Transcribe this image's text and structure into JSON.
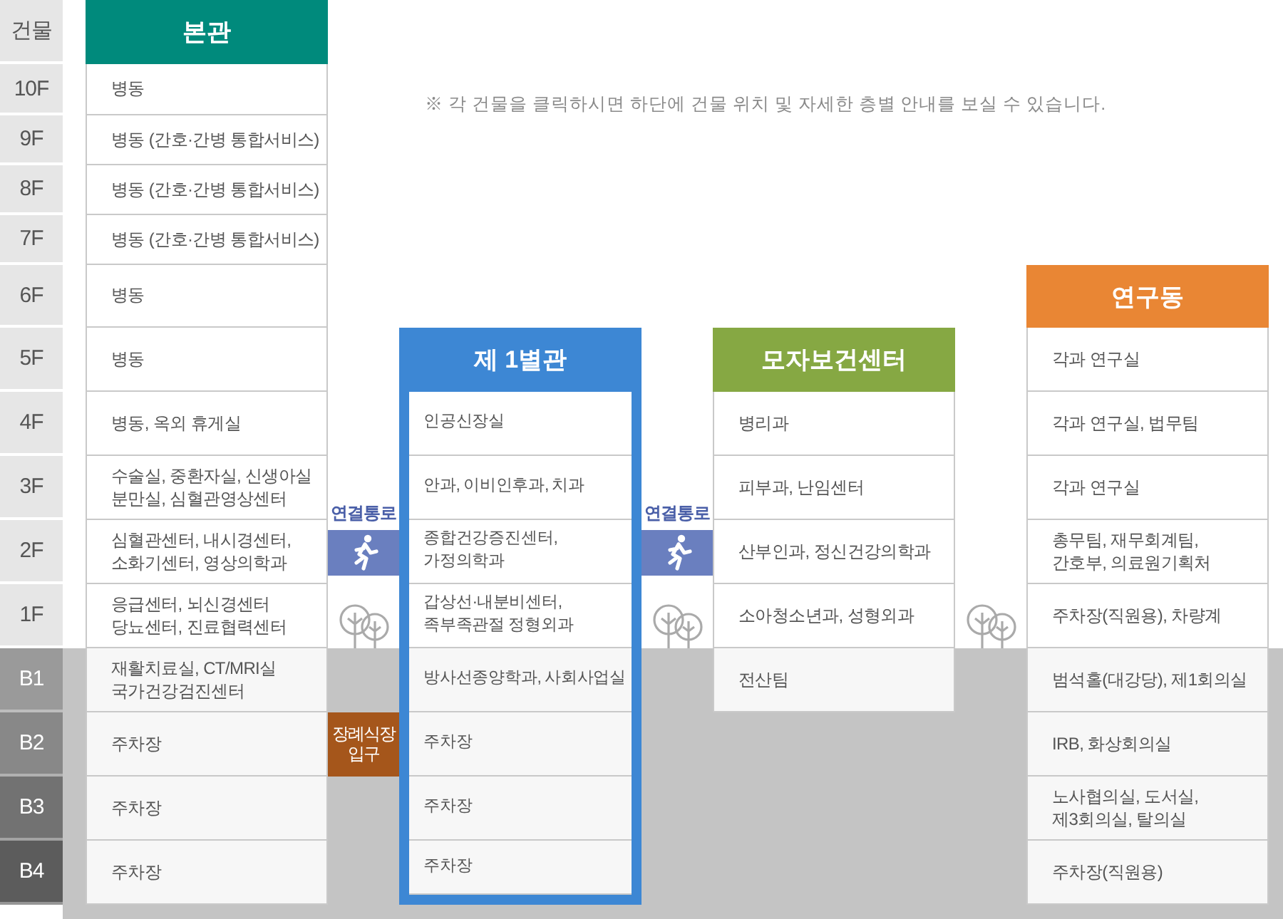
{
  "floor_header": "건물",
  "floors": [
    {
      "label": "10F",
      "underground": false
    },
    {
      "label": "9F",
      "underground": false
    },
    {
      "label": "8F",
      "underground": false
    },
    {
      "label": "7F",
      "underground": false
    },
    {
      "label": "6F",
      "underground": false
    },
    {
      "label": "5F",
      "underground": false
    },
    {
      "label": "4F",
      "underground": false
    },
    {
      "label": "3F",
      "underground": false
    },
    {
      "label": "2F",
      "underground": false
    },
    {
      "label": "1F",
      "underground": false
    },
    {
      "label": "B1",
      "underground": true
    },
    {
      "label": "B2",
      "underground": true
    },
    {
      "label": "B3",
      "underground": true
    },
    {
      "label": "B4",
      "underground": true
    }
  ],
  "note": "※ 각 건물을 클릭하시면 하단에 건물 위치 및 자세한 층별 안내를 보실 수 있습니다.",
  "buildings": [
    {
      "name": "본관",
      "color": "#008a7c",
      "rooms": [
        "병동",
        "병동 (간호·간병 통합서비스)",
        "병동 (간호·간병 통합서비스)",
        "병동 (간호·간병 통합서비스)",
        "병동",
        "병동",
        "병동, 옥외 휴게실",
        "수술실, 중환자실, 신생아실\n분만실, 심혈관영상센터",
        "심혈관센터, 내시경센터,\n소화기센터, 영상의학과",
        "응급센터, 뇌신경센터\n당뇨센터, 진료협력센터",
        "재활치료실, CT/MRI실\n국가건강검진센터",
        "주차장",
        "주차장",
        "주차장"
      ]
    },
    {
      "name": "제 1별관",
      "color": "#3d87d4",
      "rooms": [
        "인공신장실",
        "안과, 이비인후과, 치과",
        "종합건강증진센터,\n가정의학과",
        "갑상선·내분비센터,\n족부족관절 정형외과",
        "방사선종양학과, 사회사업실",
        "주차장",
        "주차장",
        "주차장"
      ]
    },
    {
      "name": "모자보건센터",
      "color": "#86a843",
      "rooms": [
        "병리과",
        "피부과, 난임센터",
        "산부인과, 정신건강의학과",
        "소아청소년과, 성형외과",
        "전산팀"
      ]
    },
    {
      "name": "연구동",
      "color": "#e98634",
      "rooms": [
        "각과 연구실",
        "각과 연구실, 법무팀",
        "각과 연구실",
        "총무팀, 재무회계팀,\n간호부, 의료원기획처",
        "주차장(직원용), 차량계",
        "범석홀(대강당), 제1회의실",
        "IRB, 화상회의실",
        "노사협의실, 도서실,\n제3회의실, 탈의실",
        "주차장(직원용)"
      ]
    }
  ],
  "links": [
    {
      "items": [
        {
          "kind": "passage",
          "label": "연결통로"
        },
        {
          "kind": "trees"
        },
        {
          "kind": "entrance",
          "label": "장례식장\n입구"
        }
      ]
    },
    {
      "items": [
        {
          "kind": "passage",
          "label": "연결통로"
        },
        {
          "kind": "trees"
        }
      ]
    },
    {
      "items": [
        {
          "kind": "trees"
        }
      ]
    }
  ]
}
